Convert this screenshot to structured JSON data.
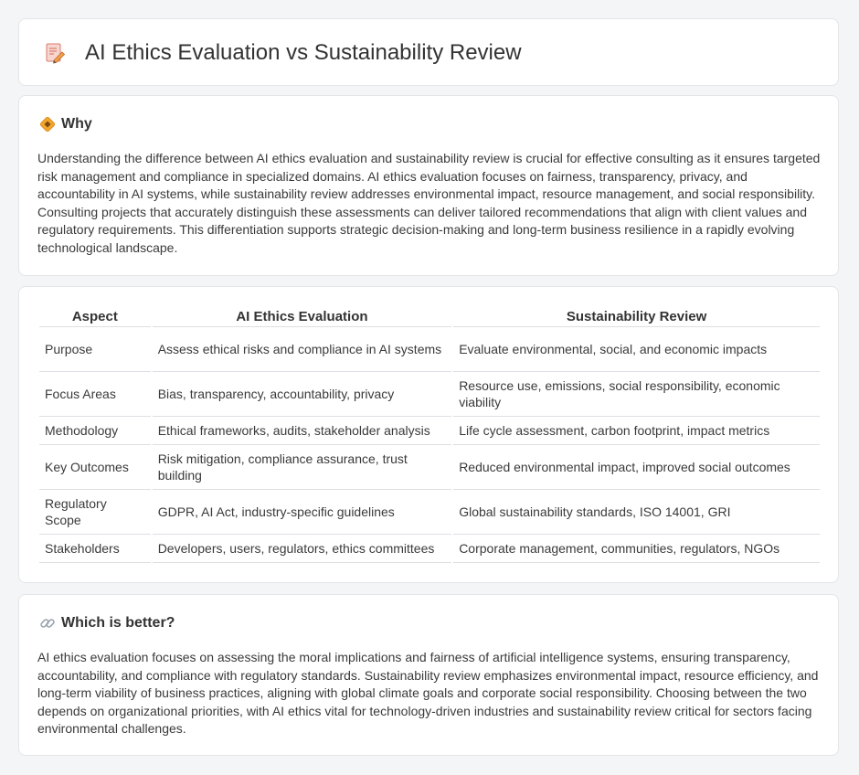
{
  "header": {
    "title": "AI Ethics Evaluation vs Sustainability Review",
    "icon": "memo-pencil-icon"
  },
  "why": {
    "icon": "diamond-sign-icon",
    "title": "Why",
    "text": "Understanding the difference between AI ethics evaluation and sustainability review is crucial for effective consulting as it ensures targeted risk management and compliance in specialized domains. AI ethics evaluation focuses on fairness, transparency, privacy, and accountability in AI systems, while sustainability review addresses environmental impact, resource management, and social responsibility. Consulting projects that accurately distinguish these assessments can deliver tailored recommendations that align with client values and regulatory requirements. This differentiation supports strategic decision-making and long-term business resilience in a rapidly evolving technological landscape."
  },
  "table": {
    "headers": [
      "Aspect",
      "AI Ethics Evaluation",
      "Sustainability Review"
    ],
    "rows": [
      [
        "Purpose",
        "Assess ethical risks and compliance in AI systems",
        "Evaluate environmental, social, and economic impacts"
      ],
      [
        "Focus Areas",
        "Bias, transparency, accountability, privacy",
        "Resource use, emissions, social responsibility, economic viability"
      ],
      [
        "Methodology",
        "Ethical frameworks, audits, stakeholder analysis",
        "Life cycle assessment, carbon footprint, impact metrics"
      ],
      [
        "Key Outcomes",
        "Risk mitigation, compliance assurance, trust building",
        "Reduced environmental impact, improved social outcomes"
      ],
      [
        "Regulatory Scope",
        "GDPR, AI Act, industry-specific guidelines",
        "Global sustainability standards, ISO 14001, GRI"
      ],
      [
        "Stakeholders",
        "Developers, users, regulators, ethics committees",
        "Corporate management, communities, regulators, NGOs"
      ]
    ]
  },
  "better": {
    "icon": "link-icon",
    "title": "Which is better?",
    "text": "AI ethics evaluation focuses on assessing the moral implications and fairness of artificial intelligence systems, ensuring transparency, accountability, and compliance with regulatory standards. Sustainability review emphasizes environmental impact, resource efficiency, and long-term viability of business practices, aligning with global climate goals and corporate social responsibility. Choosing between the two depends on organizational priorities, with AI ethics vital for technology-driven industries and sustainability review critical for sectors facing environmental challenges."
  },
  "colors": {
    "background": "#f4f5f7",
    "card": "#ffffff",
    "border": "#e3e5e9",
    "text": "#333333"
  }
}
